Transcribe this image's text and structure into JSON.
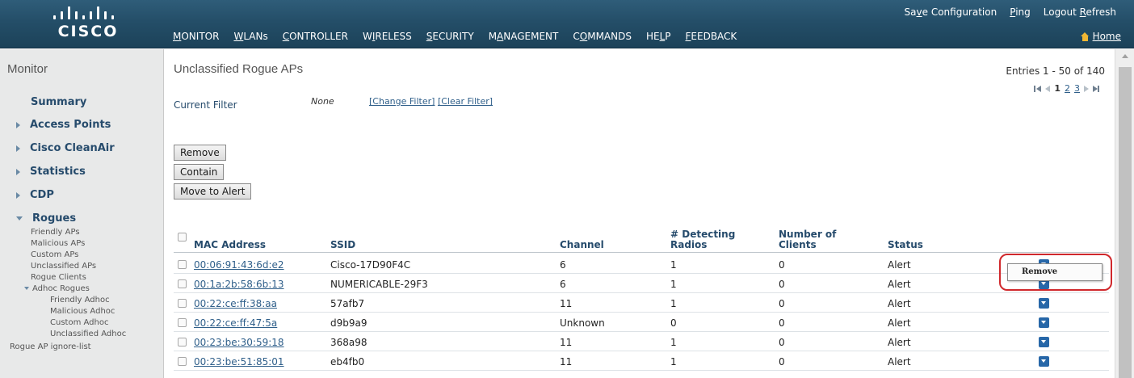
{
  "header": {
    "logo_text": "CISCO",
    "util_links": [
      {
        "pre": "Sa",
        "ul": "v",
        "post": "e Configuration"
      },
      {
        "pre": "",
        "ul": "P",
        "post": "ing"
      },
      {
        "pre": "Logout ",
        "ul": "R",
        "post": "efresh"
      }
    ],
    "home_label": "Home",
    "nav": [
      {
        "pre": "",
        "ul": "M",
        "post": "ONITOR"
      },
      {
        "pre": "",
        "ul": "W",
        "post": "LANs"
      },
      {
        "pre": "",
        "ul": "C",
        "post": "ONTROLLER"
      },
      {
        "pre": "W",
        "ul": "I",
        "post": "RELESS"
      },
      {
        "pre": "",
        "ul": "S",
        "post": "ECURITY"
      },
      {
        "pre": "M",
        "ul": "A",
        "post": "NAGEMENT"
      },
      {
        "pre": "C",
        "ul": "O",
        "post": "MMANDS"
      },
      {
        "pre": "HE",
        "ul": "L",
        "post": "P"
      },
      {
        "pre": "",
        "ul": "F",
        "post": "EEDBACK"
      }
    ]
  },
  "sidebar": {
    "title": "Monitor",
    "summary": "Summary",
    "access_points": "Access Points",
    "cleanair": "Cisco CleanAir",
    "statistics": "Statistics",
    "cdp": "CDP",
    "rogues": "Rogues",
    "friendly_aps": "Friendly APs",
    "malicious_aps": "Malicious APs",
    "custom_aps": "Custom APs",
    "unclassified_aps": "Unclassified APs",
    "rogue_clients": "Rogue Clients",
    "adhoc_rogues": "Adhoc Rogues",
    "friendly_adhoc": "Friendly Adhoc",
    "malicious_adhoc": "Malicious Adhoc",
    "custom_adhoc": "Custom Adhoc",
    "unclassified_adhoc": "Unclassified Adhoc",
    "ignore_list": "Rogue AP ignore-list"
  },
  "main": {
    "title": "Unclassified Rogue APs",
    "entries": "Entries 1 - 50 of 140",
    "pages": {
      "current": "1",
      "p2": "2",
      "p3": "3"
    },
    "filter_label": "Current Filter",
    "filter_value": "None",
    "change_filter": "[Change Filter]",
    "clear_filter": "[Clear Filter]",
    "buttons": {
      "remove": "Remove",
      "contain": "Contain",
      "move_to_alert": "Move to Alert"
    },
    "columns": {
      "mac": "MAC Address",
      "ssid": "SSID",
      "channel": "Channel",
      "detecting_1": "# Detecting",
      "detecting_2": "Radios",
      "clients_1": "Number of",
      "clients_2": "Clients",
      "status": "Status"
    },
    "rows": [
      {
        "mac": "00:06:91:43:6d:e2",
        "ssid": "Cisco-17D90F4C",
        "channel": "6",
        "radios": "1",
        "clients": "0",
        "status": "Alert"
      },
      {
        "mac": "00:1a:2b:58:6b:13",
        "ssid": "NUMERICABLE-29F3",
        "channel": "6",
        "radios": "1",
        "clients": "0",
        "status": "Alert"
      },
      {
        "mac": "00:22:ce:ff:38:aa",
        "ssid": "57afb7",
        "channel": "11",
        "radios": "1",
        "clients": "0",
        "status": "Alert"
      },
      {
        "mac": "00:22:ce:ff:47:5a",
        "ssid": "d9b9a9",
        "channel": "Unknown",
        "radios": "0",
        "clients": "0",
        "status": "Alert"
      },
      {
        "mac": "00:23:be:30:59:18",
        "ssid": "368a98",
        "channel": "11",
        "radios": "1",
        "clients": "0",
        "status": "Alert"
      },
      {
        "mac": "00:23:be:51:85:01",
        "ssid": "eb4fb0",
        "channel": "11",
        "radios": "1",
        "clients": "0",
        "status": "Alert"
      }
    ],
    "popup_option": "Remove"
  },
  "colors": {
    "header_bg": "#244e68",
    "nav_text": "#ffffff",
    "sidebar_bg": "#e8e9e9",
    "link": "#2f5f8a",
    "heading": "#264b6c",
    "row_button": "#2767a8",
    "highlight": "#d0282c",
    "home_icon": "#f2b733"
  },
  "icons": [
    "cisco-logo-bars",
    "home-icon",
    "expand-triangle-icon",
    "dropdown-arrow-icon",
    "pager-first-icon",
    "pager-prev-icon",
    "pager-next-icon",
    "pager-last-icon"
  ]
}
